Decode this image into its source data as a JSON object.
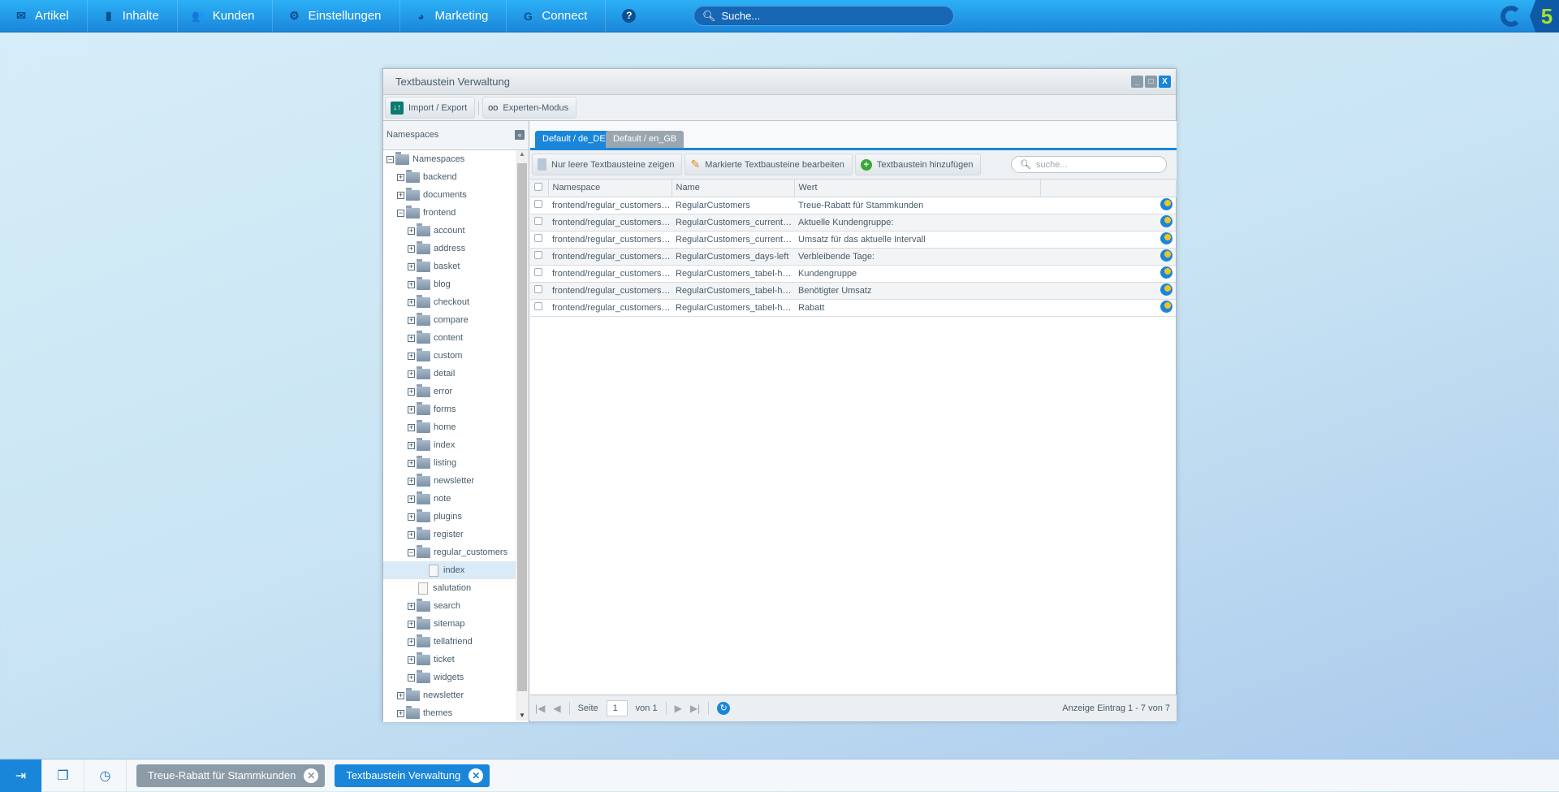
{
  "topbar": {
    "items": [
      {
        "label": "Artikel",
        "icon": "inbox-icon",
        "glyph": "✉"
      },
      {
        "label": "Inhalte",
        "icon": "document-icon",
        "glyph": "▮"
      },
      {
        "label": "Kunden",
        "icon": "users-icon",
        "glyph": "👥"
      },
      {
        "label": "Einstellungen",
        "icon": "gear-icon",
        "glyph": "⚙"
      },
      {
        "label": "Marketing",
        "icon": "pie-chart-icon",
        "glyph": "◕"
      },
      {
        "label": "Connect",
        "icon": "connect-icon",
        "glyph": "G"
      }
    ],
    "help_icon": "?",
    "search_placeholder": "Suche...",
    "logo_text": "5"
  },
  "window": {
    "title": "Textbaustein Verwaltung",
    "toolbar": {
      "import_export": "Import / Export",
      "expert_mode": "Experten-Modus"
    }
  },
  "left": {
    "title": "Namespaces",
    "tree": [
      {
        "label": "Namespaces",
        "level": 0,
        "type": "folder",
        "expanded": true
      },
      {
        "label": "backend",
        "level": 1,
        "type": "folder"
      },
      {
        "label": "documents",
        "level": 1,
        "type": "folder"
      },
      {
        "label": "frontend",
        "level": 1,
        "type": "folder",
        "expanded": true
      },
      {
        "label": "account",
        "level": 2,
        "type": "folder"
      },
      {
        "label": "address",
        "level": 2,
        "type": "folder"
      },
      {
        "label": "basket",
        "level": 2,
        "type": "folder"
      },
      {
        "label": "blog",
        "level": 2,
        "type": "folder"
      },
      {
        "label": "checkout",
        "level": 2,
        "type": "folder"
      },
      {
        "label": "compare",
        "level": 2,
        "type": "folder"
      },
      {
        "label": "content",
        "level": 2,
        "type": "folder"
      },
      {
        "label": "custom",
        "level": 2,
        "type": "folder"
      },
      {
        "label": "detail",
        "level": 2,
        "type": "folder"
      },
      {
        "label": "error",
        "level": 2,
        "type": "folder"
      },
      {
        "label": "forms",
        "level": 2,
        "type": "folder"
      },
      {
        "label": "home",
        "level": 2,
        "type": "folder"
      },
      {
        "label": "index",
        "level": 2,
        "type": "folder"
      },
      {
        "label": "listing",
        "level": 2,
        "type": "folder"
      },
      {
        "label": "newsletter",
        "level": 2,
        "type": "folder"
      },
      {
        "label": "note",
        "level": 2,
        "type": "folder"
      },
      {
        "label": "plugins",
        "level": 2,
        "type": "folder"
      },
      {
        "label": "register",
        "level": 2,
        "type": "folder"
      },
      {
        "label": "regular_customers",
        "level": 2,
        "type": "folder",
        "expanded": true
      },
      {
        "label": "index",
        "level": 3,
        "type": "file",
        "selected": true
      },
      {
        "label": "salutation",
        "level": 2,
        "type": "file"
      },
      {
        "label": "search",
        "level": 2,
        "type": "folder"
      },
      {
        "label": "sitemap",
        "level": 2,
        "type": "folder"
      },
      {
        "label": "tellafriend",
        "level": 2,
        "type": "folder"
      },
      {
        "label": "ticket",
        "level": 2,
        "type": "folder"
      },
      {
        "label": "widgets",
        "level": 2,
        "type": "folder"
      },
      {
        "label": "newsletter",
        "level": 1,
        "type": "folder"
      },
      {
        "label": "themes",
        "level": 1,
        "type": "folder"
      }
    ]
  },
  "tabs": [
    {
      "label": "Default / de_DE",
      "active": true
    },
    {
      "label": "Default / en_GB",
      "active": false
    }
  ],
  "grid_toolbar": {
    "empty_only": "Nur leere Textbausteine zeigen",
    "edit_marked": "Markierte Textbausteine bearbeiten",
    "add": "Textbaustein hinzufügen",
    "search_placeholder": "suche..."
  },
  "grid": {
    "columns": [
      "Namespace",
      "Name",
      "Wert"
    ],
    "rows": [
      [
        "frontend/regular_customers/index",
        "RegularCustomers",
        "Treue-Rabatt für Stammkunden"
      ],
      [
        "frontend/regular_customers/index",
        "RegularCustomers_current-cust...",
        "Aktuelle Kundengruppe:"
      ],
      [
        "frontend/regular_customers/index",
        "RegularCustomers_current-interval",
        "Umsatz für das aktuelle Intervall"
      ],
      [
        "frontend/regular_customers/index",
        "RegularCustomers_days-left",
        "Verbleibende Tage:"
      ],
      [
        "frontend/regular_customers/index",
        "RegularCustomers_tabel-headlin...",
        "Kundengruppe"
      ],
      [
        "frontend/regular_customers/index",
        "RegularCustomers_tabel-headlin...",
        "Benötigter Umsatz"
      ],
      [
        "frontend/regular_customers/index",
        "RegularCustomers_tabel-headlin...",
        "Rabatt"
      ]
    ]
  },
  "pager": {
    "page_label": "Seite",
    "page": "1",
    "of_label": "von 1",
    "info": "Anzeige Eintrag 1 - 7 von 7"
  },
  "footer": {
    "tasks": [
      {
        "label": "Treue-Rabatt für Stammkunden",
        "color": "#8c9ba8"
      },
      {
        "label": "Textbaustein Verwaltung",
        "color": "#1a86da"
      }
    ]
  }
}
